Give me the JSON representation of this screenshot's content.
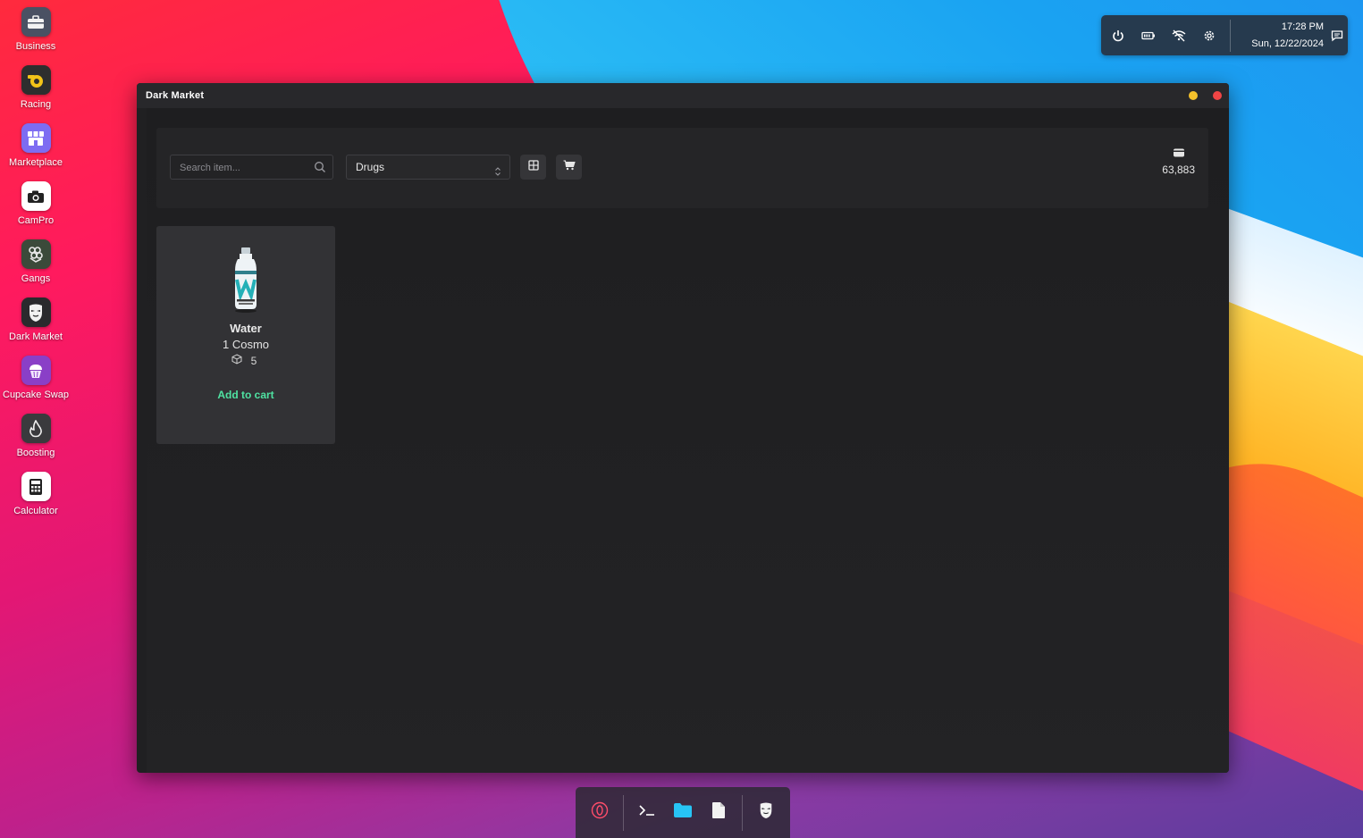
{
  "desktop": {
    "icons": [
      {
        "label": "Business"
      },
      {
        "label": "Racing"
      },
      {
        "label": "Marketplace"
      },
      {
        "label": "CamPro"
      },
      {
        "label": "Gangs"
      },
      {
        "label": "Dark Market"
      },
      {
        "label": "Cupcake Swap"
      },
      {
        "label": "Boosting"
      },
      {
        "label": "Calculator"
      }
    ]
  },
  "tray": {
    "time": "17:28 PM",
    "date": "Sun, 12/22/2024",
    "icons": [
      "power-icon",
      "battery-icon",
      "wifi-off-icon",
      "settings-icon",
      "chat-icon"
    ]
  },
  "window": {
    "title": "Dark Market",
    "search": {
      "placeholder": "Search item..."
    },
    "category": {
      "selected": "Drugs"
    },
    "balance": "63,883",
    "items": [
      {
        "name": "Water",
        "price": "1 Cosmo",
        "stock": "5",
        "action": "Add to cart"
      }
    ]
  },
  "colors": {
    "window_bg": "#202022",
    "card_bg": "#323235",
    "accent_green": "#4fe3a2",
    "tray_bg": "#263a4e"
  }
}
